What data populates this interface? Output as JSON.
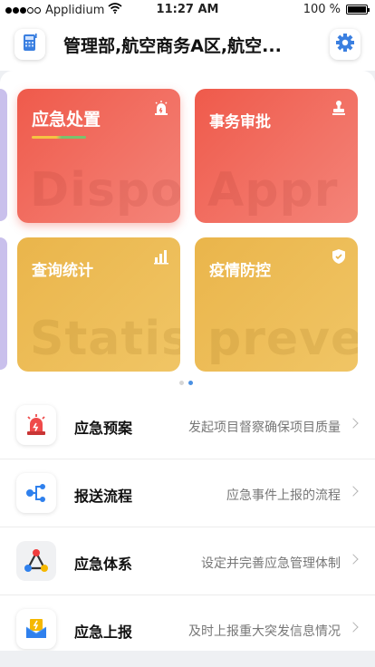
{
  "status_bar": {
    "carrier": "Applidium",
    "time": "11:27 AM",
    "battery": "100 %"
  },
  "header": {
    "title": "管理部,航空商务A区,航空...",
    "left_icon": "phone-grid-icon",
    "right_icon": "gear-icon"
  },
  "tiles": [
    {
      "title": "应急处置",
      "watermark": "Dispo",
      "icon": "alarm-siren-icon",
      "color": "#ef5a4b"
    },
    {
      "title": "事务审批",
      "watermark": "Appr",
      "icon": "stamp-icon",
      "color": "#ef5a4b"
    },
    {
      "title": "查询统计",
      "watermark": "Statis",
      "icon": "bar-chart-icon",
      "color": "#eab54b"
    },
    {
      "title": "疫情防控",
      "watermark": "preve",
      "icon": "shield-icon",
      "color": "#eab54b"
    }
  ],
  "pager": {
    "count": 2,
    "active": 2
  },
  "list": [
    {
      "title": "应急预案",
      "desc": "发起项目督察确保项目质量",
      "icon": "siren-icon"
    },
    {
      "title": "报送流程",
      "desc": "应急事件上报的流程",
      "icon": "flow-branch-icon"
    },
    {
      "title": "应急体系",
      "desc": "设定并完善应急管理体制",
      "icon": "network-triangle-icon"
    },
    {
      "title": "应急上报",
      "desc": "及时上报重大突发信息情况",
      "icon": "report-envelope-icon"
    }
  ]
}
